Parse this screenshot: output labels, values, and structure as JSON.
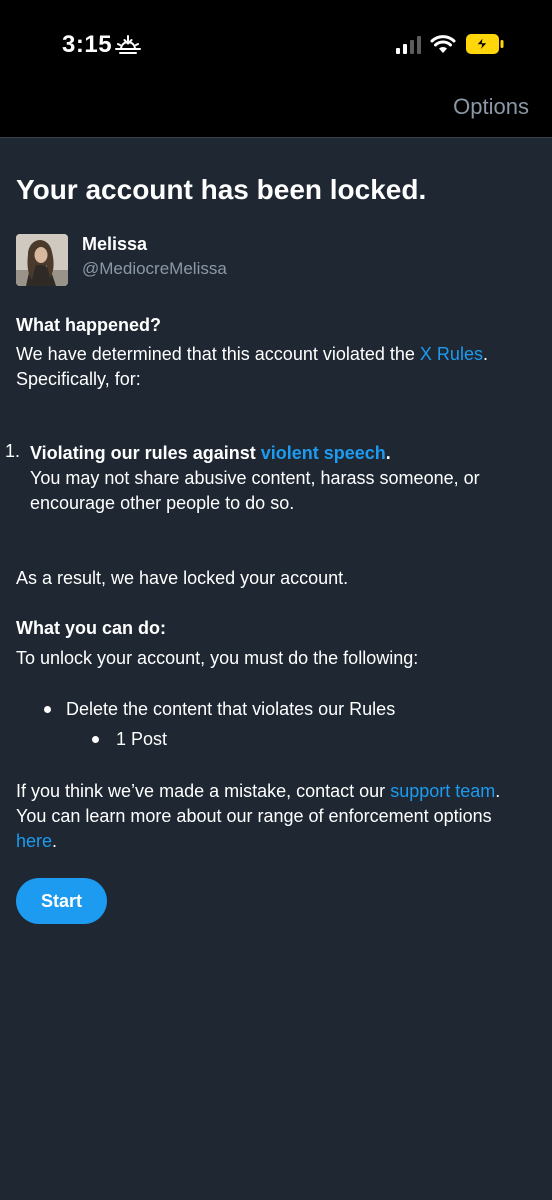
{
  "status_bar": {
    "time": "3:15"
  },
  "header": {
    "options_label": "Options"
  },
  "page": {
    "title": "Your account has been locked."
  },
  "account": {
    "display_name": "Melissa",
    "handle": "@MediocreMelissa"
  },
  "what_happened": {
    "heading": "What happened?",
    "text_before_link": "We have determined that this account violated the ",
    "rules_link": "X Rules",
    "text_after_link": ".",
    "line2": "Specifically, for:"
  },
  "violation": {
    "number": "1.",
    "title_prefix": "Violating our rules against ",
    "title_link": "violent speech",
    "title_suffix": ".",
    "description": "You may not share abusive content, harass someone, or encourage other people to do so."
  },
  "result_text": "As a result, we have locked your account.",
  "what_you_can_do": {
    "heading": "What you can do:",
    "text": "To unlock your account, you must do the following:",
    "steps": [
      "Delete the content that violates our Rules",
      "1 Post"
    ]
  },
  "mistake": {
    "text_before_link": "If you think we’ve made a mistake, contact our ",
    "support_link": "support team",
    "text_middle": ". You can learn more about our range of enforcement options ",
    "here_link": "here",
    "text_end": "."
  },
  "start_button_label": "Start",
  "colors": {
    "background": "#1e2732",
    "topbar": "#000000",
    "accent": "#1d9bf0",
    "secondary_text": "#8b98a5",
    "battery": "#ffd60a"
  },
  "icons": {
    "status": [
      "sunset-icon",
      "signal-icon",
      "wifi-icon",
      "battery-charging-icon"
    ]
  }
}
